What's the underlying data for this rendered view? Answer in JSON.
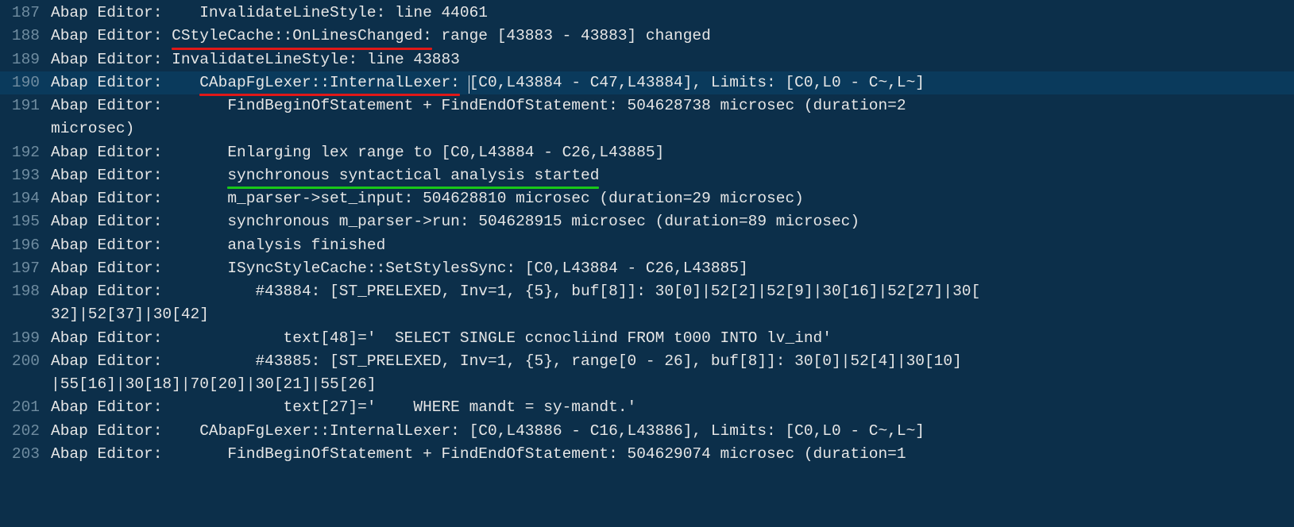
{
  "current_line": 190,
  "lines": [
    {
      "num": 187,
      "prefix": "Abap Editor:    InvalidateLineStyle: line 44061",
      "segments": []
    },
    {
      "num": 188,
      "prefix": "Abap Editor: ",
      "segments": [
        {
          "text": "CStyleCache::OnLinesChanged:",
          "mark": "red"
        },
        {
          "text": " range [43883 - 43883] changed"
        }
      ]
    },
    {
      "num": 189,
      "prefix": "Abap Editor: InvalidateLineStyle: line 43883",
      "segments": []
    },
    {
      "num": 190,
      "prefix": "Abap Editor:    ",
      "segments": [
        {
          "text": "CAbapFgLexer::InternalLexer:",
          "mark": "red"
        },
        {
          "text": " ",
          "cursor_after": true
        },
        {
          "text": "[C0,L43884 - C47,L43884], Limits: [C0,L0 - C~,L~]"
        }
      ]
    },
    {
      "num": 191,
      "prefix": "Abap Editor:       FindBeginOfStatement + FindEndOfStatement: 504628738 microsec (duration=2 ",
      "wrap": "microsec)",
      "segments": []
    },
    {
      "num": 192,
      "prefix": "Abap Editor:       Enlarging lex range to [C0,L43884 - C26,L43885]",
      "segments": []
    },
    {
      "num": 193,
      "prefix": "Abap Editor:       ",
      "segments": [
        {
          "text": "synchronous syntactical analysis started",
          "mark": "green"
        }
      ]
    },
    {
      "num": 194,
      "prefix": "Abap Editor:       m_parser->set_input: 504628810 microsec (duration=29 microsec)",
      "segments": []
    },
    {
      "num": 195,
      "prefix": "Abap Editor:       synchronous m_parser->run: 504628915 microsec (duration=89 microsec)",
      "segments": []
    },
    {
      "num": 196,
      "prefix": "Abap Editor:       analysis finished",
      "segments": []
    },
    {
      "num": 197,
      "prefix": "Abap Editor:       ISyncStyleCache::SetStylesSync: [C0,L43884 - C26,L43885]",
      "segments": []
    },
    {
      "num": 198,
      "prefix": "Abap Editor:          #43884: [ST_PRELEXED, Inv=1, {5}, buf[8]]: 30[0]|52[2]|52[9]|30[16]|52[27]|30[",
      "wrap": "32]|52[37]|30[42]",
      "segments": []
    },
    {
      "num": 199,
      "prefix": "Abap Editor:             text[48]='  SELECT SINGLE ccnocliind FROM t000 INTO lv_ind'",
      "segments": []
    },
    {
      "num": 200,
      "prefix": "Abap Editor:          #43885: [ST_PRELEXED, Inv=1, {5}, range[0 - 26], buf[8]]: 30[0]|52[4]|30[10]",
      "wrap": "|55[16]|30[18]|70[20]|30[21]|55[26]",
      "segments": []
    },
    {
      "num": 201,
      "prefix": "Abap Editor:             text[27]='    WHERE mandt = sy-mandt.'",
      "segments": []
    },
    {
      "num": 202,
      "prefix": "Abap Editor:    CAbapFgLexer::InternalLexer: [C0,L43886 - C16,L43886], Limits: [C0,L0 - C~,L~]",
      "segments": []
    },
    {
      "num": 203,
      "prefix": "Abap Editor:       FindBeginOfStatement + FindEndOfStatement: 504629074 microsec (duration=1 ",
      "segments": []
    }
  ]
}
